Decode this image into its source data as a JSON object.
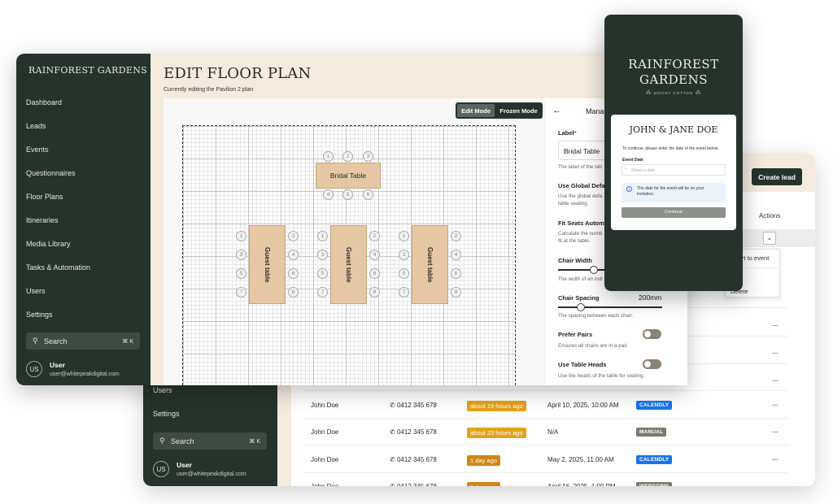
{
  "leads_window": {
    "sidebar": {
      "items": [
        "Users",
        "Settings"
      ],
      "search_label": "Search",
      "search_shortcut": "⌘ K",
      "user": {
        "initials": "US",
        "name": "User",
        "email": "user@whitepeakdigital.com"
      }
    },
    "create_lead_label": "Create lead",
    "actions_header": "Actions",
    "dropdown": {
      "items": [
        "vert to event",
        "Delete"
      ]
    },
    "rows": [
      {
        "name": "John Doe",
        "phone": "0412 345 678",
        "time": "about 19 hours ago",
        "time_color": "#e3a21a",
        "date": "April 10, 2025, 10:00 AM",
        "source": "CALENDLY",
        "source_color": "#1a73e8"
      },
      {
        "name": "John Doe",
        "phone": "0412 345 678",
        "time": "about 23 hours ago",
        "time_color": "#e3a21a",
        "date": "N/A",
        "source": "MANUAL",
        "source_color": "#7b7a6b"
      },
      {
        "name": "John Doe",
        "phone": "0412 345 678",
        "time": "1 day ago",
        "time_color": "#d08514",
        "date": "May 2, 2025, 11:00 AM",
        "source": "CALENDLY",
        "source_color": "#1a73e8"
      },
      {
        "name": "John Doe",
        "phone": "0412 345 678",
        "time": "1 day ago",
        "time_color": "#d08514",
        "date": "April 16, 2025, 1:00 PM",
        "source": "WEBFORM",
        "source_color": "#7b7a6b"
      }
    ]
  },
  "floor_plan_window": {
    "brand": "RAINFOREST GARDENS",
    "sidebar": {
      "items": [
        "Dashboard",
        "Leads",
        "Events",
        "Questionnaires",
        "Floor Plans",
        "Itineraries",
        "Media Library",
        "Tasks & Automation",
        "Users",
        "Settings"
      ],
      "search_label": "Search",
      "search_shortcut": "⌘ K",
      "user": {
        "initials": "US",
        "name": "User",
        "email": "user@whitepeakdigital.com"
      }
    },
    "page_title": "EDIT FLOOR PLAN",
    "page_subtitle": "Currently editing the Pavilion 2 plan",
    "modes": {
      "edit": "Edit Mode",
      "frozen": "Frozen Mode"
    },
    "tables": {
      "bridal": {
        "label": "Bridal Table",
        "seats_top": [
          "1",
          "2",
          "3"
        ],
        "seats_bottom": [
          "4",
          "5",
          "6"
        ]
      },
      "guest_label": "Guest table",
      "guest_seats_left": [
        "1",
        "3",
        "5",
        "7"
      ],
      "guest_seats_right": [
        "2",
        "4",
        "6",
        "8"
      ]
    },
    "side_panel": {
      "header": "Mana",
      "label_field": {
        "label": "Label",
        "required_mark": "*",
        "value": "Bridal Table",
        "help": "The label of the tab"
      },
      "use_global": {
        "label": "Use Global Defau",
        "help": "Use the global defa table seating."
      },
      "fit_seats": {
        "label": "Fit Seats Automa",
        "help": "Calculate the numb fit at the table."
      },
      "chair_width": {
        "label": "Chair Width",
        "help": "The width of an indi"
      },
      "chair_spacing": {
        "label": "Chair Spacing",
        "value": "200mm",
        "help": "The spacing between each chair."
      },
      "prefer_pairs": {
        "label": "Prefer Pairs",
        "help": "Ensures all chairs are in a pair."
      },
      "table_heads": {
        "label": "Use Table Heads",
        "help": "Use the heads of the table for seating."
      }
    }
  },
  "phone": {
    "brand_line1": "RAINFOREST",
    "brand_line2": "GARDENS",
    "brand_sub": "MOUNT COTTON",
    "couple": "JOHN & JANE DOE",
    "instruction": "To continue, please enter the date of the event below.",
    "field_label": "Event Date",
    "field_placeholder": "Select a date",
    "info": "The date for the event will be on your invitation.",
    "continue": "Continue"
  }
}
